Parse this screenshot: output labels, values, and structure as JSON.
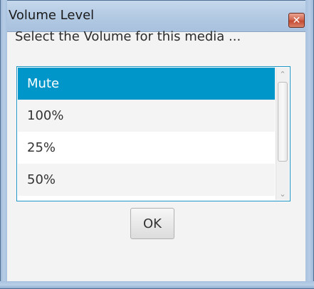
{
  "window": {
    "title": "Volume Level",
    "close_glyph": "✕",
    "close_icon": "close-icon"
  },
  "dialog": {
    "prompt": "Select the Volume for this media ..."
  },
  "volume_list": {
    "items": [
      {
        "label": "Mute",
        "selected": true
      },
      {
        "label": "100%",
        "selected": false
      },
      {
        "label": "25%",
        "selected": false
      },
      {
        "label": "50%",
        "selected": false
      }
    ],
    "accent_color": "#0096c9"
  },
  "scrollbar": {
    "up_glyph": "⌃",
    "down_glyph": "⌄"
  },
  "buttons": {
    "ok_label": "OK"
  }
}
